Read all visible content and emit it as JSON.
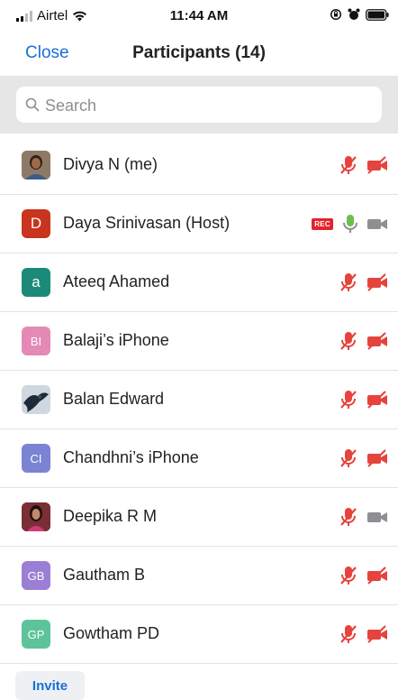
{
  "status_bar": {
    "carrier": "Airtel",
    "time": "11:44 AM"
  },
  "header": {
    "close_label": "Close",
    "title": "Participants (14)"
  },
  "search": {
    "placeholder": "Search"
  },
  "participants": [
    {
      "name": "Divya N (me)",
      "avatar": "photo",
      "mic": "muted",
      "video": "off"
    },
    {
      "name": "Daya Srinivasan (Host)",
      "avatar": "D",
      "avatar_color": "#c9341e",
      "recording": true,
      "rec_label": "REC",
      "mic": "active",
      "video": "on-inactive"
    },
    {
      "name": "Ateeq Ahamed",
      "avatar": "a",
      "avatar_color": "#1b8a78",
      "mic": "muted",
      "video": "off"
    },
    {
      "name": "Balaji’s iPhone",
      "avatar": "BI",
      "avatar_color": "#e48ab5",
      "mic": "muted",
      "video": "off"
    },
    {
      "name": "Balan Edward",
      "avatar": "photo",
      "mic": "muted",
      "video": "off"
    },
    {
      "name": "Chandhni’s iPhone",
      "avatar": "CI",
      "avatar_color": "#7b83d4",
      "mic": "muted",
      "video": "off"
    },
    {
      "name": "Deepika R M",
      "avatar": "photo",
      "mic": "muted",
      "video": "on-inactive"
    },
    {
      "name": "Gautham B",
      "avatar": "GB",
      "avatar_color": "#9b7fd4",
      "mic": "muted",
      "video": "off"
    },
    {
      "name": "Gowtham PD",
      "avatar": "GP",
      "avatar_color": "#5cc39a",
      "mic": "muted",
      "video": "off"
    }
  ],
  "footer": {
    "invite_label": "Invite"
  },
  "colors": {
    "accent": "#1a6fd6",
    "muted_red": "#e5443d",
    "active_green": "#6cc04a",
    "inactive_gray": "#8e8e93"
  }
}
